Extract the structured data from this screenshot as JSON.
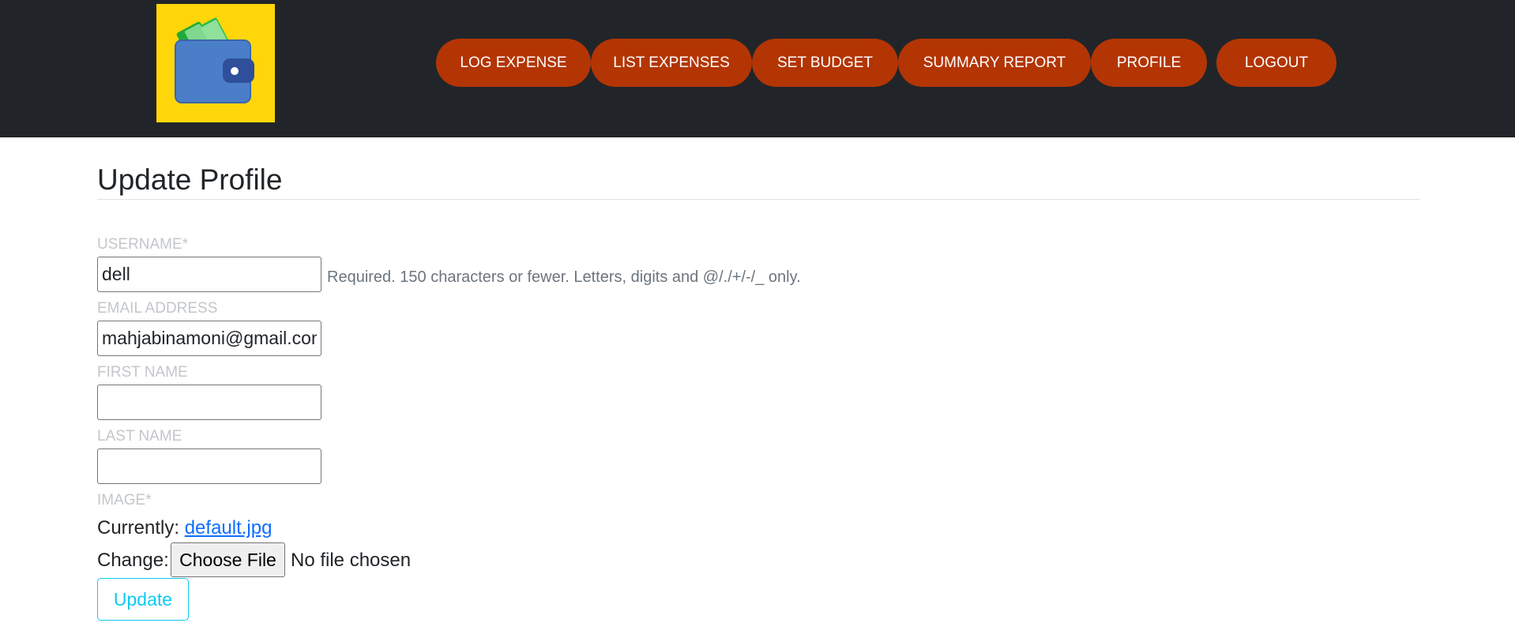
{
  "nav": {
    "logo_icon": "wallet-icon",
    "items": [
      {
        "label": "LOG EXPENSE"
      },
      {
        "label": "LIST EXPENSES"
      },
      {
        "label": "SET BUDGET"
      },
      {
        "label": "SUMMARY REPORT"
      },
      {
        "label": "PROFILE"
      },
      {
        "label": "LOGOUT"
      }
    ],
    "colors": {
      "bar": "#212529",
      "button": "#b33504",
      "logo_bg": "#ffd60a"
    }
  },
  "page": {
    "title": "Update Profile"
  },
  "form": {
    "username": {
      "label": "USERNAME*",
      "value": "dell",
      "help": "Required. 150 characters or fewer. Letters, digits and @/./+/-/_ only."
    },
    "email": {
      "label": "EMAIL ADDRESS",
      "value": "mahjabinamoni@gmail.com"
    },
    "first_name": {
      "label": "FIRST NAME",
      "value": ""
    },
    "last_name": {
      "label": "LAST NAME",
      "value": ""
    },
    "image": {
      "label": "IMAGE*",
      "currently_label": "Currently:",
      "current_file": "default.jpg",
      "change_label": "Change:",
      "choose_button": "Choose File",
      "no_file_text": "No file chosen"
    },
    "submit_label": "Update"
  }
}
